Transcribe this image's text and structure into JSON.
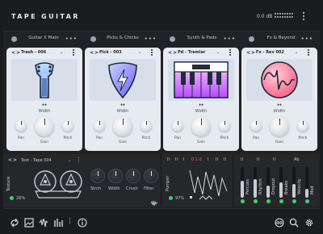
{
  "app": {
    "title": "TAPE GUITAR",
    "output_level": "0.0 dB"
  },
  "slots": [
    {
      "name": "Guitar X Main",
      "more": "•••"
    },
    {
      "name": "Picks & Chicks",
      "more": "•••"
    },
    {
      "name": "Synth & Pads",
      "more": "•••"
    },
    {
      "name": "Fx & Beyond",
      "more": "•••"
    }
  ],
  "cards": [
    {
      "preset": "Trash - 006",
      "width_label": "Width",
      "pan_label": "Pan",
      "gain_label": "Gain",
      "pitch_label": "Pitch",
      "art_icon": "guitar-icon"
    },
    {
      "preset": "Pick - 003",
      "width_label": "Width",
      "pan_label": "Pan",
      "gain_label": "Gain",
      "pitch_label": "Pitch",
      "art_icon": "pick-icon"
    },
    {
      "preset": "Pd - Tremlar",
      "width_label": "Width",
      "pan_label": "Pan",
      "gain_label": "Gain",
      "pitch_label": "Pitch",
      "art_icon": "synth-keyboard-icon"
    },
    {
      "preset": "Fx - Rev 002",
      "width_label": "Width",
      "pan_label": "Pan",
      "gain_label": "Gain",
      "pitch_label": "Pitch",
      "art_icon": "wave-circle-icon"
    }
  ],
  "glyphs": {
    "chev_left": "<",
    "chev_right": ">",
    "caret": "⌄",
    "width_arrows": "↔"
  },
  "texture": {
    "preset": "Text - Tape 004",
    "label": "Texture",
    "amount": "26%",
    "knobs": [
      "Strch",
      "Width",
      "Crush",
      "Filter"
    ]
  },
  "pumper": {
    "label": "Pumper",
    "amount": "97%",
    "transport": [
      "II",
      "II",
      "I",
      "0 1 0",
      "I",
      "II",
      "II"
    ]
  },
  "modulators": {
    "transport": [
      "II",
      "II",
      "II",
      "Ab"
    ],
    "labels": [
      "Percuss",
      "Rhythm",
      "Dropout",
      "Breaks",
      "Velocity",
      "Mod"
    ],
    "levels": [
      0.55,
      0.6,
      0.4,
      0.5,
      0.45,
      0.3
    ]
  },
  "footer": {
    "icons": [
      "loop-icon",
      "image-icon",
      "waveform-icon",
      "eq-bars-icon",
      "info-icon",
      "pack-icon",
      "search-icon",
      "settings-icon"
    ]
  },
  "colors": {
    "accent_green": "#39d36a",
    "accent_purple": "#b44cff",
    "accent_pink": "#ff5fa2"
  }
}
